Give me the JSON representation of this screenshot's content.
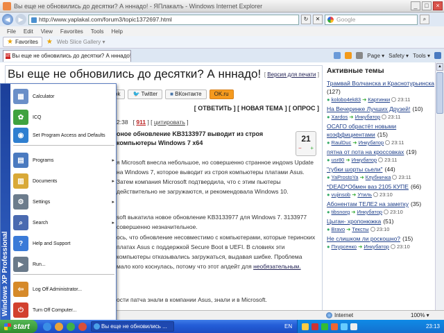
{
  "window": {
    "title": "Вы еще не обновились до десятки? А нннадо! - ЯПлакалъ - Windows Internet Explorer",
    "controls": [
      "_",
      "□",
      "×"
    ]
  },
  "address": {
    "url": "http://www.yaplakal.com/forum3/topic1372697.html",
    "search_placeholder": "Google"
  },
  "menu": [
    "File",
    "Edit",
    "View",
    "Favorites",
    "Tools",
    "Help"
  ],
  "favbar": {
    "favorites": "Favorites",
    "gallery": "Web Slice Gallery ▾"
  },
  "tab": {
    "icon_text": "ЯП",
    "label": "Вы еще не обновились до десятки? А нннадо! - ЯП..."
  },
  "commands": [
    "Page ▾",
    "Safety ▾",
    "Tools ▾"
  ],
  "article": {
    "headline": "Вы еще не обновились до десятки? А нннадо!",
    "print_prefix": "[",
    "print_link": "Версия для печати",
    "print_suffix": "]",
    "share": {
      "fb_tail": "ok",
      "twitter": "Twitter",
      "vk": "ВКонтакте",
      "ok": "OK.ru"
    },
    "actions": "[ ОТВЕТИТЬ ] [ НОВАЯ ТЕМА ] [ ОПРОС ]",
    "meta_time": "2:38",
    "meta_num": "911",
    "meta_quote": "цитировать",
    "post_title": "оное обновление KB3133977 выводит из строя компьютеры Windows 7 x64",
    "rating": "21",
    "p1": "я Microsoft внесла небольшое, но совершенно странное индows Update на Windows 7, которое выводит из строя компьютеры платами Asus. Затем компания Microsoft подтвердила, что с этим пьютеры действительно не загружаются, и рекомендовала Windows 10.",
    "p2": "soft выкатила новое обновление KB3133977 для Windows 7. 3133977 совершенно незначительное.",
    "p3": "ось, что обновление несовместимо с компьютерами, которые теринских платах Asus с поддержкой Secure Boot в UEFI. В словиях эти компьютеры отказывались загружаться, выдавая шибке. Проблема мало кого коснулась, потому что этот апдейт для",
    "p3_link": "необязательным.",
    "p4": "ости патча знали в компании Asus, знали и в Microsoft."
  },
  "sidebar": {
    "title": "Активные темы",
    "topics": [
      {
        "title": "Трамвай Волчанска и Краснотурьинска",
        "count": "(127)",
        "user": "kolobo4ek83",
        "section": "Картинки",
        "time": "23:11"
      },
      {
        "title": "На Вечеринке Лучших Друзей!",
        "count": "(10)",
        "user": "Xardos",
        "section": "Инкубатор",
        "time": "23:11"
      },
      {
        "title": "ОСАГО обрастёт новыми коэффициентами",
        "count": "(15)",
        "user": "RaulDuc",
        "section": "Инкубатор",
        "time": "23:11"
      },
      {
        "title": "пятна от пота на кроссовках",
        "count": "(19)",
        "user": "usr80",
        "section": "Инкубатор",
        "time": "23:11"
      },
      {
        "title": "\"губки шорты сьели\"",
        "count": "(44)",
        "user": "YaProstoYa",
        "section": "Клубничка",
        "time": "23:11"
      },
      {
        "title": "*DEAD*Обмен ваз 2105 КУПЕ",
        "count": "(66)",
        "user": "vujinsob",
        "section": "Утиль",
        "time": "23:10"
      },
      {
        "title": "Абонентам ТЕЛЕ2 на заметку",
        "count": "(35)",
        "user": "tibsnorg",
        "section": "Инкубатор",
        "time": "23:10"
      },
      {
        "title": "Цыган- хропонюжка",
        "count": "(51)",
        "user": "Bravo",
        "section": "Тексты",
        "time": "23:10"
      },
      {
        "title": "Не слишком ли роскошно?",
        "count": "(15)",
        "user": "Пхурсенко",
        "section": "Инкубатор",
        "time": "23:10"
      }
    ]
  },
  "startmenu": {
    "side_label": "Windows XP Professional",
    "items": [
      {
        "label": "Calculator",
        "icon": "calculator-icon",
        "arrow": ""
      },
      {
        "label": "ICQ",
        "icon": "icq-icon",
        "arrow": ""
      },
      {
        "label": "Set Program Access and Defaults",
        "icon": "defaults-icon",
        "arrow": ""
      },
      {
        "label": "Programs",
        "icon": "programs-icon",
        "arrow": "▸"
      },
      {
        "label": "Documents",
        "icon": "documents-icon",
        "arrow": "▸"
      },
      {
        "label": "Settings",
        "icon": "settings-icon",
        "arrow": "▸"
      },
      {
        "label": "Search",
        "icon": "search-icon",
        "arrow": "▸"
      },
      {
        "label": "Help and Support",
        "icon": "help-icon",
        "arrow": ""
      },
      {
        "label": "Run...",
        "icon": "run-icon",
        "arrow": ""
      },
      {
        "label": "Log Off Administrator...",
        "icon": "logoff-icon",
        "arrow": ""
      },
      {
        "label": "Turn Off Computer...",
        "icon": "power-icon",
        "arrow": ""
      }
    ]
  },
  "status": {
    "zone": "Internet",
    "zoom": "100% ▾"
  },
  "taskbar": {
    "start": "start",
    "task": "Вы еще не обновились ...",
    "lang": "EN",
    "clock": "23:13"
  },
  "colors": {
    "link": "#1e3f8a",
    "accent_red": "#b22222",
    "taskbar": "#245ed8",
    "start_green": "#2e8c2e"
  }
}
